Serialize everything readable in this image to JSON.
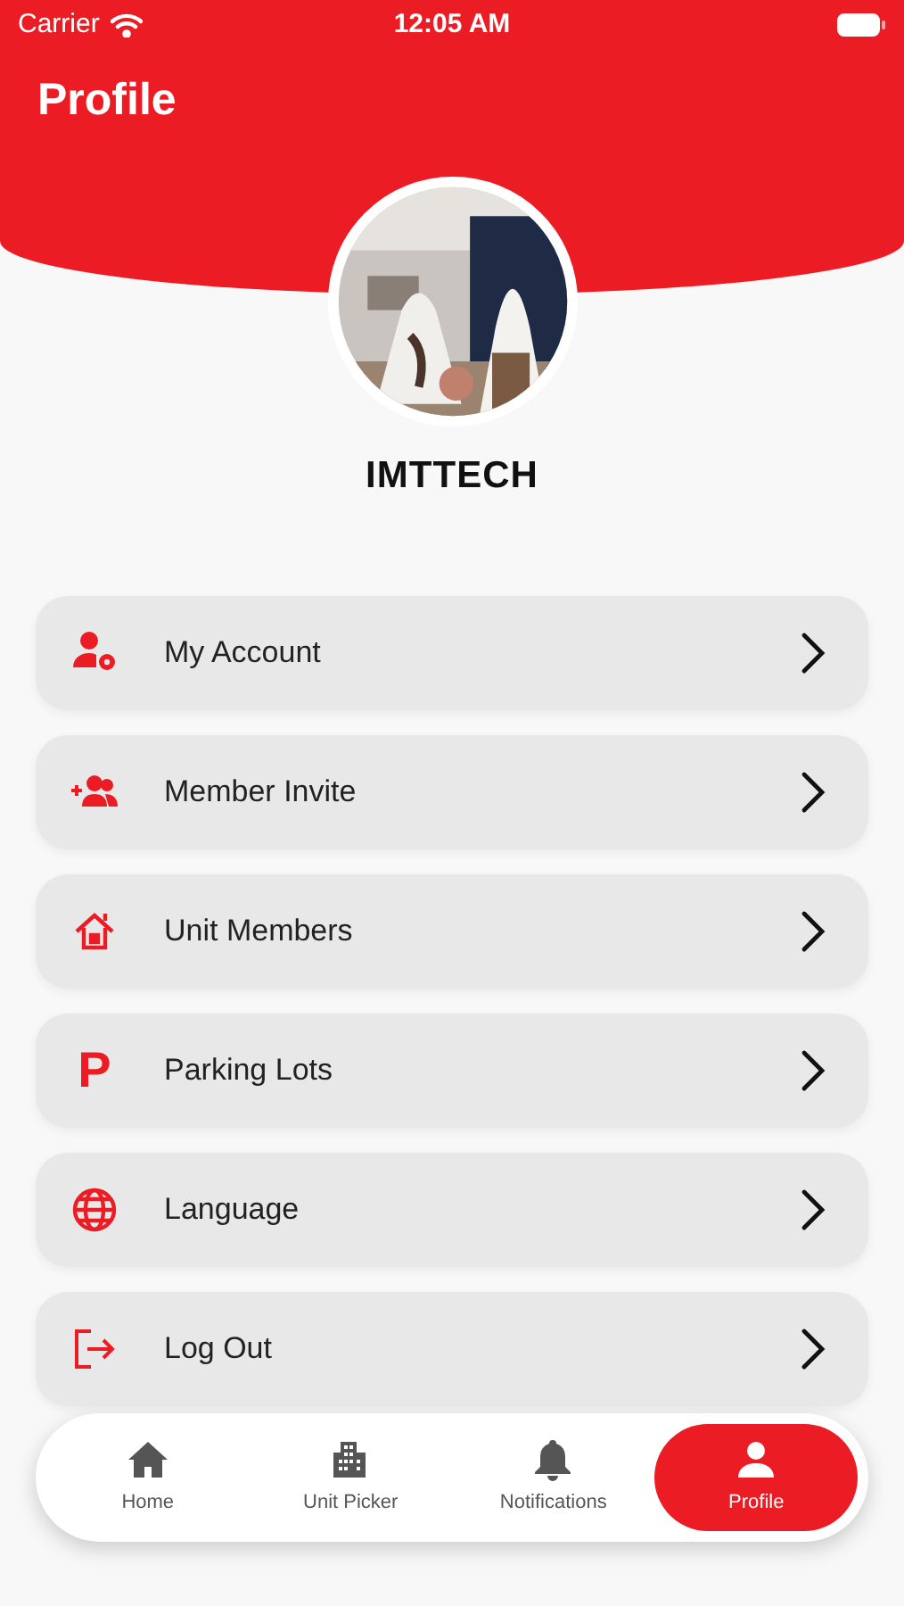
{
  "status_bar": {
    "carrier": "Carrier",
    "time": "12:05 AM"
  },
  "header": {
    "title": "Profile"
  },
  "profile": {
    "name": "IMTTECH"
  },
  "menu": [
    {
      "kind": "account",
      "label": "My Account"
    },
    {
      "kind": "invite",
      "label": "Member Invite"
    },
    {
      "kind": "unit",
      "label": "Unit Members"
    },
    {
      "kind": "parking",
      "glyph": "P",
      "label": "Parking Lots"
    },
    {
      "kind": "language",
      "label": "Language"
    },
    {
      "kind": "logout",
      "label": "Log Out"
    }
  ],
  "tab_bar": [
    {
      "kind": "home",
      "label": "Home",
      "selected": false
    },
    {
      "kind": "building",
      "label": "Unit Picker",
      "selected": false
    },
    {
      "kind": "bell",
      "label": "Notifications",
      "selected": false
    },
    {
      "kind": "person",
      "label": "Profile",
      "selected": true
    }
  ]
}
